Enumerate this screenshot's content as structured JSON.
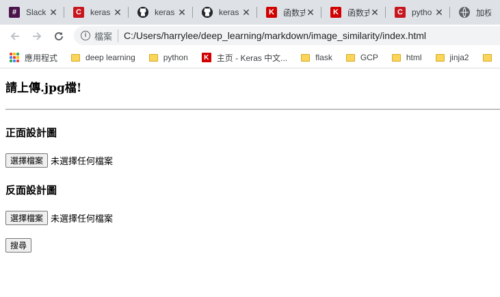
{
  "tabs": [
    {
      "title": "Slack",
      "icon": "slack-icon"
    },
    {
      "title": "keras",
      "icon": "csdn-icon"
    },
    {
      "title": "keras",
      "icon": "github-icon"
    },
    {
      "title": "keras",
      "icon": "github-icon"
    },
    {
      "title": "函数式",
      "icon": "keras-k-icon"
    },
    {
      "title": "函数式",
      "icon": "keras-k-icon"
    },
    {
      "title": "pytho",
      "icon": "csdn-icon"
    },
    {
      "title": "加权随",
      "icon": "globe-icon"
    }
  ],
  "toolbar": {
    "scheme_label": "檔案",
    "url": "C:/Users/harrylee/deep_learning/markdown/image_similarity/index.html"
  },
  "bookmarks": [
    {
      "label": "應用程式",
      "icon": "apps-icon"
    },
    {
      "label": "deep learning",
      "icon": "folder-icon"
    },
    {
      "label": "python",
      "icon": "folder-icon"
    },
    {
      "label": "主页 - Keras 中文...",
      "icon": "keras-k-icon"
    },
    {
      "label": "flask",
      "icon": "folder-icon"
    },
    {
      "label": "GCP",
      "icon": "folder-icon"
    },
    {
      "label": "html",
      "icon": "folder-icon"
    },
    {
      "label": "jinja2",
      "icon": "folder-icon"
    }
  ],
  "page": {
    "heading": "請上傳.jpg檔!",
    "front_label": "正面設計圖",
    "back_label": "反面設計圖",
    "choose_file_label": "選擇檔案",
    "no_file_text": "未選擇任何檔案",
    "search_button": "搜尋"
  }
}
